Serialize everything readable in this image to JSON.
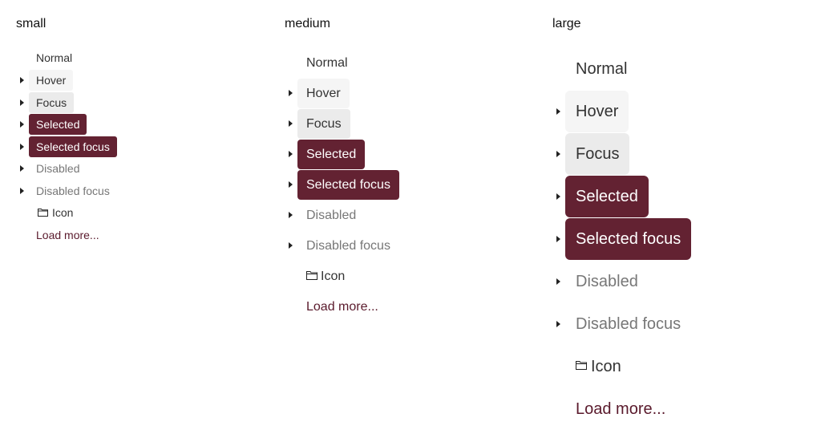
{
  "columns": [
    {
      "title": "small",
      "items": [
        {
          "label": "Normal",
          "state": "normal",
          "caret": false
        },
        {
          "label": "Hover",
          "state": "hover",
          "caret": true
        },
        {
          "label": "Focus",
          "state": "focus",
          "caret": true
        },
        {
          "label": "Selected",
          "state": "selected",
          "caret": true
        },
        {
          "label": "Selected focus",
          "state": "selected-focus",
          "caret": true
        },
        {
          "label": "Disabled",
          "state": "disabled",
          "caret": true
        },
        {
          "label": "Disabled focus",
          "state": "disabled-focus",
          "caret": true
        },
        {
          "label": "Icon",
          "state": "icon",
          "caret": false,
          "icon": "folder-icon"
        },
        {
          "label": "Load more...",
          "state": "load",
          "caret": false
        }
      ]
    },
    {
      "title": "medium",
      "items": [
        {
          "label": "Normal",
          "state": "normal",
          "caret": false
        },
        {
          "label": "Hover",
          "state": "hover",
          "caret": true
        },
        {
          "label": "Focus",
          "state": "focus",
          "caret": true
        },
        {
          "label": "Selected",
          "state": "selected",
          "caret": true
        },
        {
          "label": "Selected focus",
          "state": "selected-focus",
          "caret": true
        },
        {
          "label": "Disabled",
          "state": "disabled",
          "caret": true
        },
        {
          "label": "Disabled focus",
          "state": "disabled-focus",
          "caret": true
        },
        {
          "label": "Icon",
          "state": "icon",
          "caret": false,
          "icon": "folder-icon"
        },
        {
          "label": "Load more...",
          "state": "load",
          "caret": false
        }
      ]
    },
    {
      "title": "large",
      "items": [
        {
          "label": "Normal",
          "state": "normal",
          "caret": false
        },
        {
          "label": "Hover",
          "state": "hover",
          "caret": true
        },
        {
          "label": "Focus",
          "state": "focus",
          "caret": true
        },
        {
          "label": "Selected",
          "state": "selected",
          "caret": true
        },
        {
          "label": "Selected focus",
          "state": "selected-focus",
          "caret": true
        },
        {
          "label": "Disabled",
          "state": "disabled",
          "caret": true
        },
        {
          "label": "Disabled focus",
          "state": "disabled-focus",
          "caret": true
        },
        {
          "label": "Icon",
          "state": "icon",
          "caret": false,
          "icon": "folder-icon"
        },
        {
          "label": "Load more...",
          "state": "load",
          "caret": false
        }
      ]
    }
  ],
  "colors": {
    "selected_bg": "#632232",
    "hover_bg": "#f5f5f5",
    "focus_bg": "#ebebeb",
    "disabled_text": "#777777",
    "link_text": "#5a1a2c"
  }
}
